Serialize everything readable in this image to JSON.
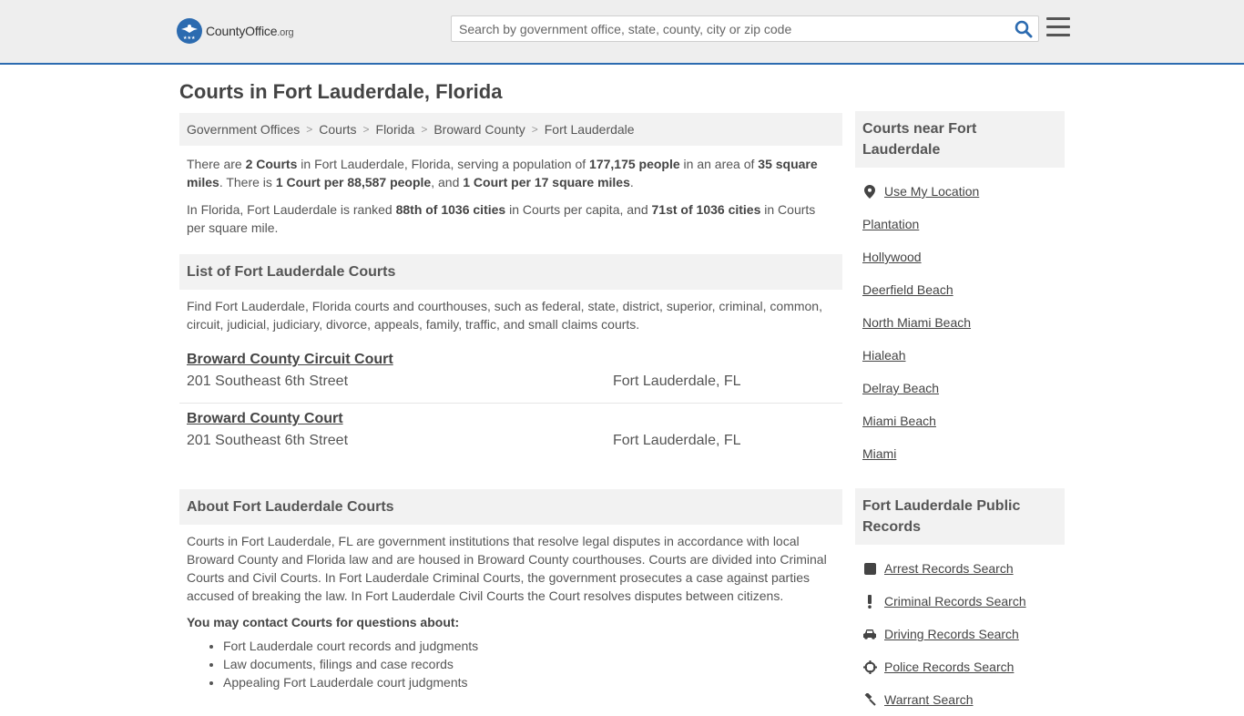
{
  "header": {
    "logo_text_a": "County",
    "logo_text_b": "Office",
    "logo_text_c": ".org",
    "search_placeholder": "Search by government office, state, county, city or zip code"
  },
  "page_title": "Courts in Fort Lauderdale, Florida",
  "breadcrumb": [
    "Government Offices",
    "Courts",
    "Florida",
    "Broward County",
    "Fort Lauderdale"
  ],
  "intro": {
    "p1_a": "There are ",
    "p1_b": "2 Courts",
    "p1_c": " in Fort Lauderdale, Florida, serving a population of ",
    "p1_d": "177,175 people",
    "p1_e": " in an area of ",
    "p1_f": "35 square miles",
    "p1_g": ". There is ",
    "p1_h": "1 Court per 88,587 people",
    "p1_i": ", and ",
    "p1_j": "1 Court per 17 square miles",
    "p1_k": ".",
    "p2_a": "In Florida, Fort Lauderdale is ranked ",
    "p2_b": "88th of 1036 cities",
    "p2_c": " in Courts per capita, and ",
    "p2_d": "71st of 1036 cities",
    "p2_e": " in Courts per square mile."
  },
  "list_section": {
    "title": "List of Fort Lauderdale Courts",
    "description": "Find Fort Lauderdale, Florida courts and courthouses, such as federal, state, district, superior, criminal, common, circuit, judicial, judiciary, divorce, appeals, family, traffic, and small claims courts.",
    "courts": [
      {
        "name": "Broward County Circuit Court",
        "address": "201 Southeast 6th Street",
        "city": "Fort Lauderdale, FL"
      },
      {
        "name": "Broward County Court",
        "address": "201 Southeast 6th Street",
        "city": "Fort Lauderdale, FL"
      }
    ]
  },
  "about_section": {
    "title": "About Fort Lauderdale Courts",
    "body": "Courts in Fort Lauderdale, FL are government institutions that resolve legal disputes in accordance with local Broward County and Florida law and are housed in Broward County courthouses. Courts are divided into Criminal Courts and Civil Courts. In Fort Lauderdale Criminal Courts, the government prosecutes a case against parties accused of breaking the law. In Fort Lauderdale Civil Courts the Court resolves disputes between citizens.",
    "subhead": "You may contact Courts for questions about:",
    "topics": [
      "Fort Lauderdale court records and judgments",
      "Law documents, filings and case records",
      "Appealing Fort Lauderdale court judgments"
    ]
  },
  "sidebar": {
    "nearby_title": "Courts near Fort Lauderdale",
    "use_location": "Use My Location",
    "nearby": [
      "Plantation",
      "Hollywood",
      "Deerfield Beach",
      "North Miami Beach",
      "Hialeah",
      "Delray Beach",
      "Miami Beach",
      "Miami"
    ],
    "records_title": "Fort Lauderdale Public Records",
    "records": [
      {
        "label": "Arrest Records Search",
        "icon": "square-icon"
      },
      {
        "label": "Criminal Records Search",
        "icon": "exclamation-icon"
      },
      {
        "label": "Driving Records Search",
        "icon": "car-icon"
      },
      {
        "label": "Police Records Search",
        "icon": "crosshair-icon"
      },
      {
        "label": "Warrant Search",
        "icon": "gavel-icon"
      }
    ]
  }
}
